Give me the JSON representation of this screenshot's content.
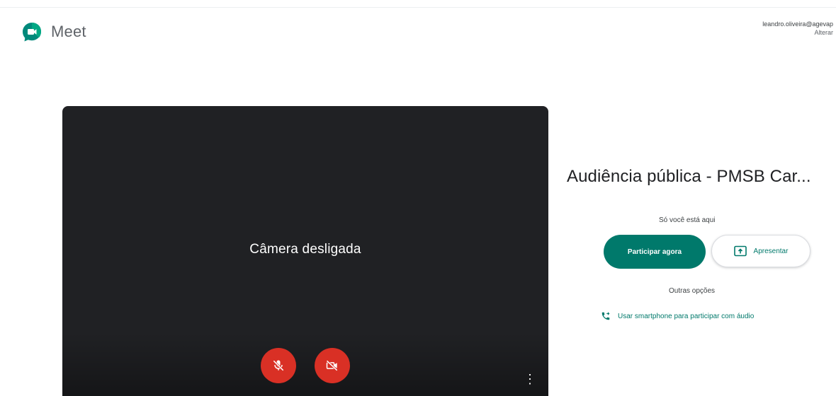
{
  "app": {
    "name": "Meet",
    "logo_icon": "meet-logo-icon",
    "brand_color": "#00796b"
  },
  "account": {
    "email": "leandro.oliveira@agevap",
    "switch_label": "Alterar"
  },
  "preview": {
    "camera_status": "Câmera desligada",
    "mic_icon": "mic-off-icon",
    "camera_icon": "videocam-off-icon",
    "more_icon": "more-vert-icon",
    "more_glyph": "⋮",
    "control_color": "#d93025"
  },
  "join": {
    "meeting_title": "Audiência pública - PMSB Car...",
    "presence_text": "Só você está aqui",
    "join_button": "Participar agora",
    "present_button": "Apresentar",
    "present_icon": "present-to-all-icon",
    "other_options": "Outras opções",
    "phone_option": "Usar smartphone para participar com áudio",
    "phone_icon": "phone-forwarded-icon"
  }
}
